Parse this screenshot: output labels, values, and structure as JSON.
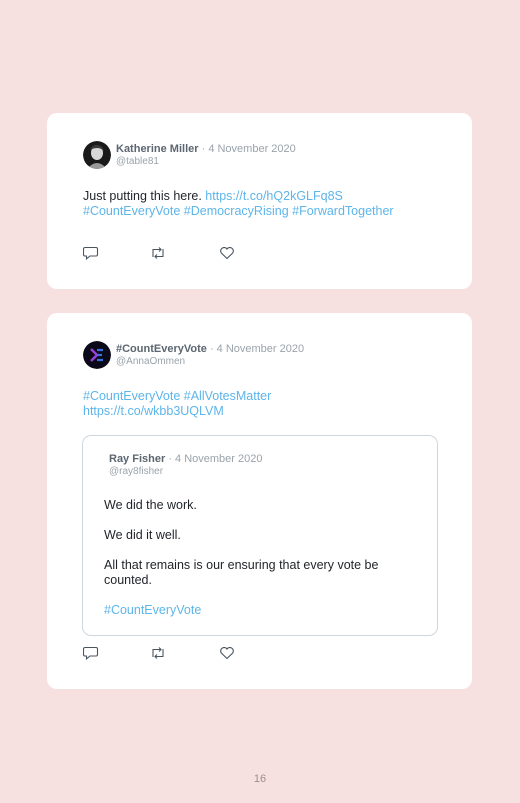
{
  "tweet1": {
    "author": "Katherine Miller",
    "date": "· 4 November 2020",
    "handle": "@table81",
    "text_plain": "Just putting this here. ",
    "link": "https://t.co/hQ2kGLFq8S",
    "hashtags": "#CountEveryVote #DemocracyRising #ForwardTogether"
  },
  "tweet2": {
    "author": "#CountEveryVote",
    "date": "· 4 November 2020",
    "handle": "@AnnaOmmen",
    "hashtags": "#CountEveryVote #AllVotesMatter",
    "link": "https://t.co/wkbb3UQLVM",
    "quote": {
      "author": "Ray Fisher",
      "date": "· 4 November 2020",
      "handle": "@ray8fisher",
      "line1": "We did the work.",
      "line2": "We did it well.",
      "line3a": "All that remains is our ensuring that every vote be",
      "line3b": "counted.",
      "hashtag": "#CountEveryVote"
    }
  },
  "icons": {
    "reply": "reply-icon",
    "retweet": "retweet-icon",
    "like": "heart-icon"
  },
  "page_number": "16"
}
